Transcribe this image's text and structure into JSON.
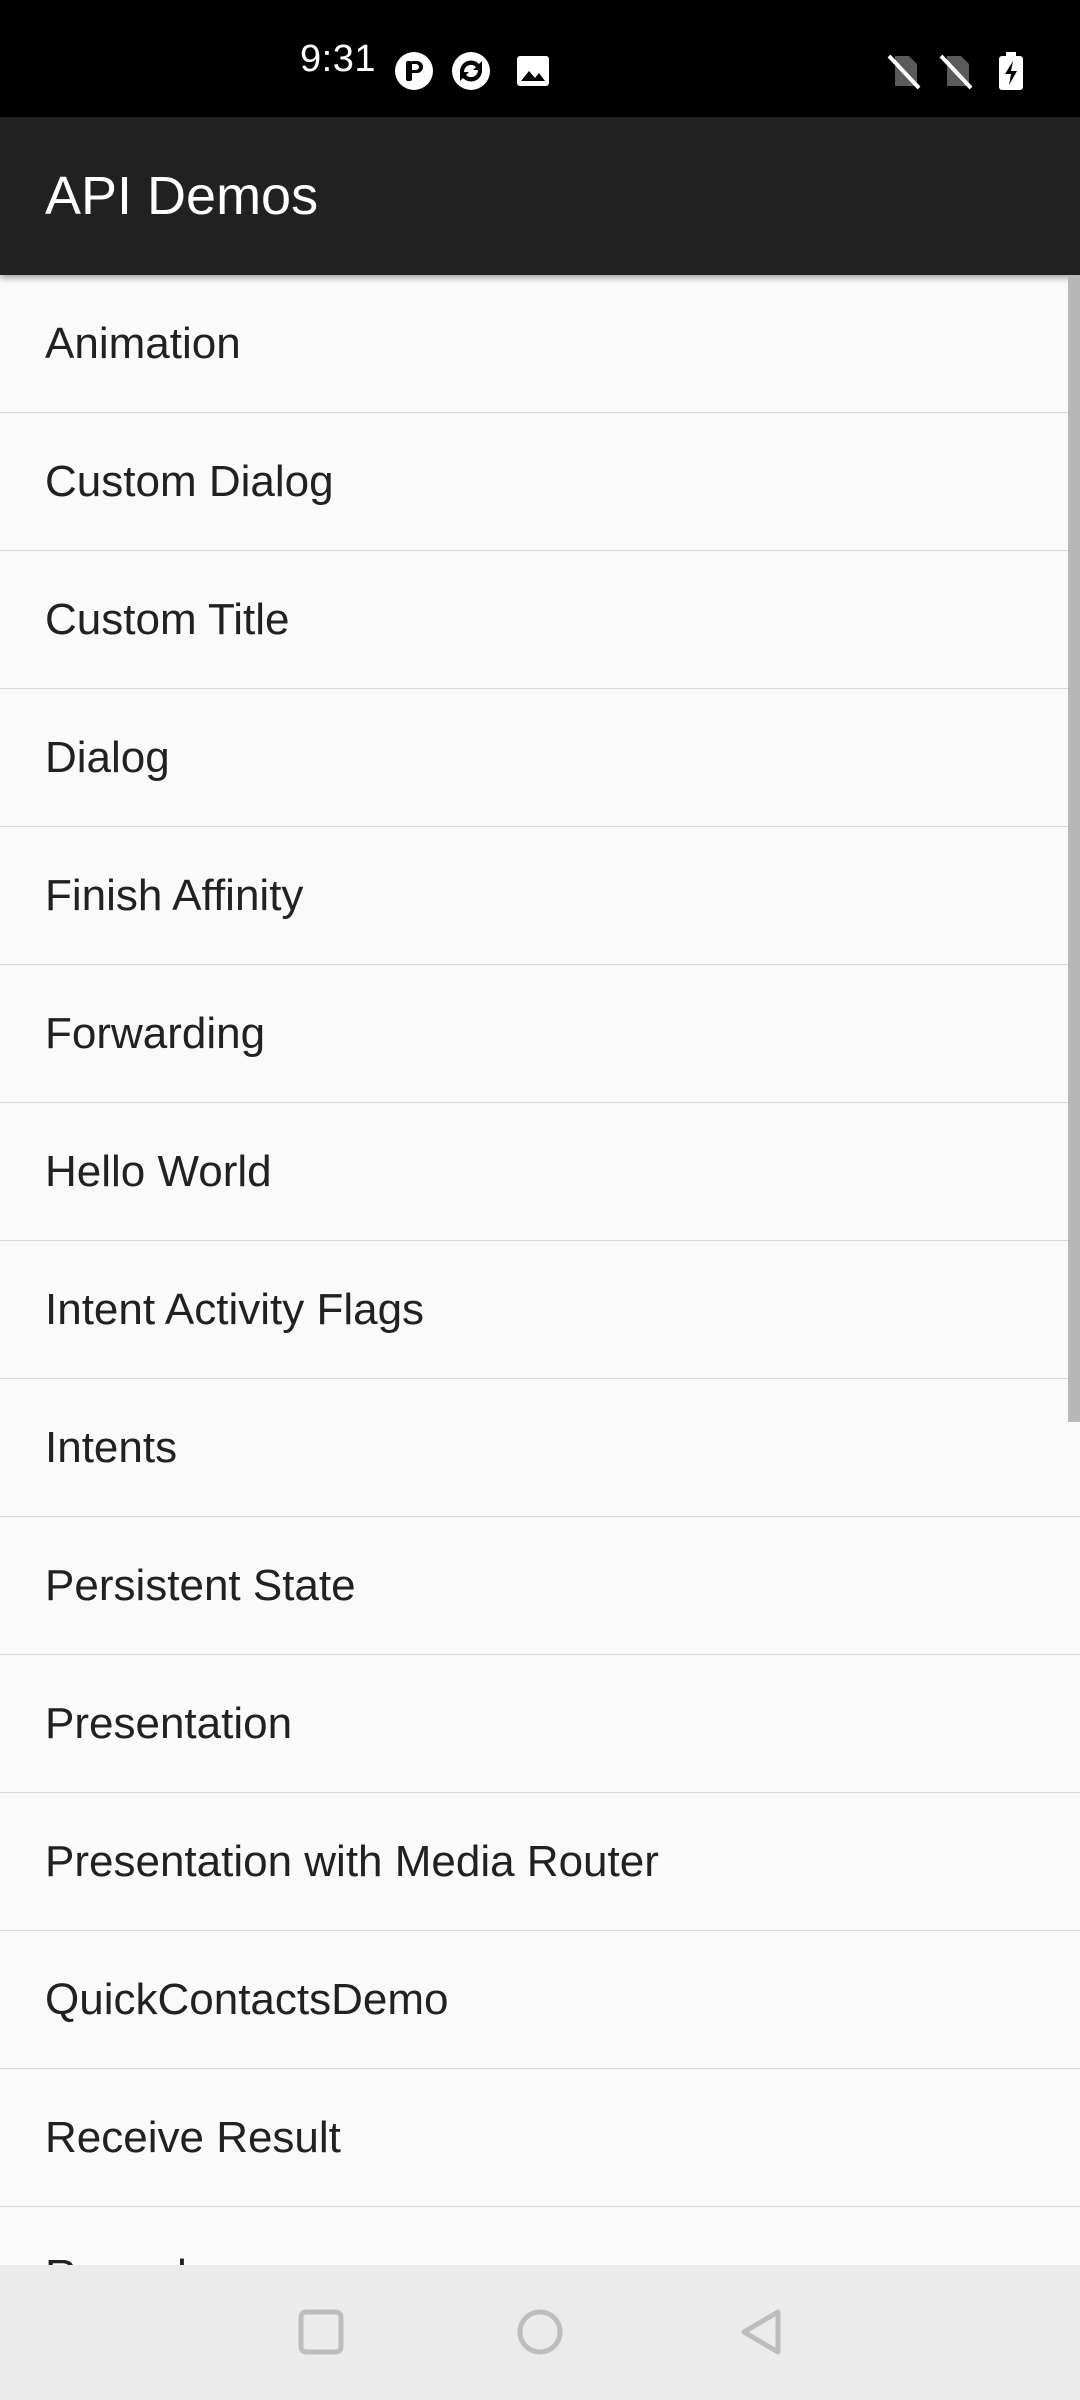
{
  "status_bar": {
    "time": "9:31",
    "icons": [
      "notification-app-icon",
      "sync-icon",
      "image-icon",
      "no-sim-icon",
      "no-sim-icon",
      "battery-charging-icon"
    ]
  },
  "app_bar": {
    "title": "API Demos"
  },
  "list": {
    "items": [
      {
        "label": "Animation"
      },
      {
        "label": "Custom Dialog"
      },
      {
        "label": "Custom Title"
      },
      {
        "label": "Dialog"
      },
      {
        "label": "Finish Affinity"
      },
      {
        "label": "Forwarding"
      },
      {
        "label": "Hello World"
      },
      {
        "label": "Intent Activity Flags"
      },
      {
        "label": "Intents"
      },
      {
        "label": "Persistent State"
      },
      {
        "label": "Presentation"
      },
      {
        "label": "Presentation with Media Router"
      },
      {
        "label": "QuickContactsDemo"
      },
      {
        "label": "Receive Result"
      },
      {
        "label": "Recorder"
      }
    ]
  },
  "nav_bar": {
    "buttons": [
      "recents-icon",
      "home-icon",
      "back-icon"
    ]
  },
  "colors": {
    "status_bar": "#000000",
    "app_bar": "#212121",
    "list_background": "#fafafa",
    "divider": "#d6d6d6",
    "nav_bar": "#ebebeb"
  }
}
